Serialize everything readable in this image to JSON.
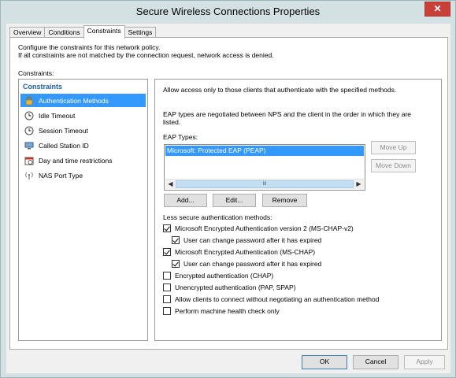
{
  "window": {
    "title": "Secure Wireless Connections Properties",
    "close_glyph": "✕"
  },
  "tabs": [
    {
      "label": "Overview",
      "active": false
    },
    {
      "label": "Conditions",
      "active": false
    },
    {
      "label": "Constraints",
      "active": true
    },
    {
      "label": "Settings",
      "active": false
    }
  ],
  "intro": {
    "line1": "Configure the constraints for this network policy.",
    "line2": "If all constraints are not matched by the connection request, network access is denied."
  },
  "constraints_label": "Constraints:",
  "constraints_list": {
    "header": "Constraints",
    "items": [
      {
        "label": "Authentication Methods",
        "icon": "lock-icon",
        "selected": true
      },
      {
        "label": "Idle Timeout",
        "icon": "clock-icon",
        "selected": false
      },
      {
        "label": "Session Timeout",
        "icon": "clock-icon",
        "selected": false
      },
      {
        "label": "Called Station ID",
        "icon": "computer-icon",
        "selected": false
      },
      {
        "label": "Day and time restrictions",
        "icon": "calendar-icon",
        "selected": false
      },
      {
        "label": "NAS Port Type",
        "icon": "antenna-icon",
        "selected": false
      }
    ]
  },
  "details": {
    "description": "Allow access only to those clients that authenticate with the specified methods.",
    "eap_note_line1": "EAP types are negotiated between NPS and the client in the order in which they are",
    "eap_note_line2": "listed.",
    "eap_types_label": "EAP Types:",
    "eap_types": [
      "Microsoft: Protected EAP (PEAP)"
    ],
    "move_up": "Move Up",
    "move_down": "Move Down",
    "add": "Add...",
    "edit": "Edit...",
    "remove": "Remove",
    "scroll_thumb_grip": "III",
    "less_secure_label": "Less secure authentication methods:",
    "methods": [
      {
        "label": "Microsoft Encrypted Authentication version 2 (MS-CHAP-v2)",
        "checked": true,
        "indent": false
      },
      {
        "label": "User can change password after it has expired",
        "checked": true,
        "indent": true
      },
      {
        "label": "Microsoft Encrypted Authentication (MS-CHAP)",
        "checked": true,
        "indent": false
      },
      {
        "label": "User can change password after it has expired",
        "checked": true,
        "indent": true
      },
      {
        "label": "Encrypted authentication (CHAP)",
        "checked": false,
        "indent": false
      },
      {
        "label": "Unencrypted authentication (PAP, SPAP)",
        "checked": false,
        "indent": false
      },
      {
        "label": "Allow clients to connect without negotiating an authentication method",
        "checked": false,
        "indent": false
      },
      {
        "label": "Perform machine health check only",
        "checked": false,
        "indent": false
      }
    ]
  },
  "footer": {
    "ok": "OK",
    "cancel": "Cancel",
    "apply": "Apply"
  }
}
